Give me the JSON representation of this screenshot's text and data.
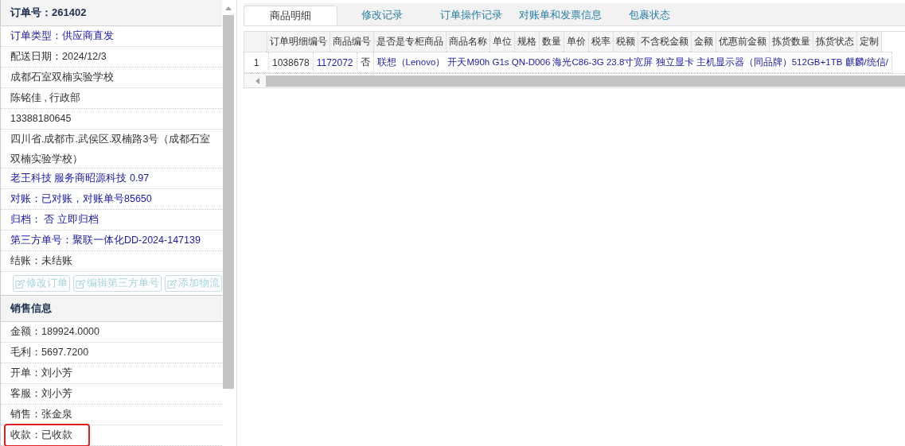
{
  "order_panel": {
    "title": "订单号：261402",
    "rows": [
      {
        "kind": "link",
        "text": "订单类型：供应商直发",
        "highlighted": false
      },
      {
        "kind": "plain",
        "text": "配送日期：2024/12/3",
        "highlighted": false
      },
      {
        "kind": "plain",
        "text": "成都石室双楠实验学校",
        "highlighted": false
      },
      {
        "kind": "plain",
        "text": "陈铭佳 , 行政部",
        "highlighted": false
      },
      {
        "kind": "plain",
        "text": "13388180645",
        "highlighted": false
      },
      {
        "kind": "plain",
        "text": "四川省.成都市.武侯区.双楠路3号（成都石室双楠实验学校）",
        "highlighted": false
      },
      {
        "kind": "link",
        "text": "老王科技 服务商昭源科技 0.97",
        "highlighted": false
      },
      {
        "kind": "link",
        "text": "对账：已对账，对账单号85650",
        "highlighted": false
      },
      {
        "kind": "link",
        "text": "归档： 否 立即归档",
        "highlighted": false
      },
      {
        "kind": "link",
        "text": "第三方单号：聚联一体化DD-2024-147139",
        "highlighted": false
      },
      {
        "kind": "plain",
        "text": "结账：未结账",
        "highlighted": false
      }
    ],
    "buttons": [
      {
        "label": "修改订单",
        "disabled": true
      },
      {
        "label": "编辑第三方单号",
        "disabled": true
      },
      {
        "label": "添加物流",
        "disabled": true
      }
    ]
  },
  "sales_panel": {
    "title": "销售信息",
    "rows": [
      {
        "text": "金额：189924.0000",
        "highlighted": false
      },
      {
        "text": "毛利：5697.7200",
        "highlighted": false
      },
      {
        "text": "开单：刘小芳",
        "highlighted": false
      },
      {
        "text": "客服：刘小芳",
        "highlighted": false
      },
      {
        "text": "销售：张金泉",
        "highlighted": false
      },
      {
        "text": "收款：已收款",
        "highlighted": true
      }
    ]
  },
  "tabs": [
    {
      "label": "商品明细",
      "selected": true
    },
    {
      "label": "修改记录",
      "selected": false
    },
    {
      "label": "订单操作记录",
      "selected": false
    },
    {
      "label": "对账单和发票信息",
      "selected": false
    },
    {
      "label": "包裹状态",
      "selected": false
    }
  ],
  "table": {
    "columns": [
      "订单明细编号",
      "商品编号",
      "是否是专柜商品",
      "商品名称",
      "单位",
      "规格",
      "数量",
      "单价",
      "税率",
      "税额",
      "不含税金额",
      "金额",
      "优惠前金额",
      "拣货数量",
      "拣货状态",
      "定制"
    ],
    "rows": [
      {
        "row_number": "1",
        "detail_id": "1038678",
        "product_id": "1172072",
        "counter_product": "否",
        "product_name": "联想（Lenovo） 开天M90h G1s QN-D006 海光C86-3G 23.8寸宽屏 独立显卡 主机显示器（同品牌）512GB+1TB 麒麟/统信/"
      }
    ]
  }
}
